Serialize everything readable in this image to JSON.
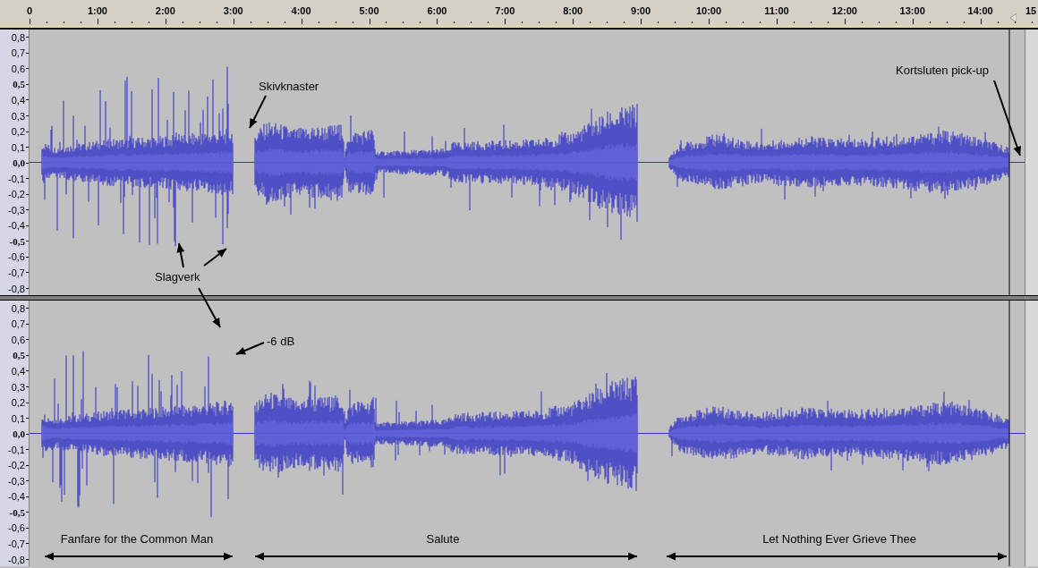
{
  "ruler": {
    "ticks": [
      "0",
      "1:00",
      "2:00",
      "3:00",
      "4:00",
      "5:00",
      "6:00",
      "7:00",
      "8:00",
      "9:00",
      "10:00",
      "11:00",
      "12:00",
      "13:00",
      "14:00",
      "15"
    ]
  },
  "tracks": [
    {
      "axis_labels": [
        {
          "text": "0,8",
          "bold": false
        },
        {
          "text": "0,7",
          "bold": false
        },
        {
          "text": "0,6",
          "bold": false
        },
        {
          "text": "0,5",
          "bold": true
        },
        {
          "text": "0,4",
          "bold": false
        },
        {
          "text": "0,3",
          "bold": false
        },
        {
          "text": "0,2",
          "bold": false
        },
        {
          "text": "0,1",
          "bold": false
        },
        {
          "text": "0,0",
          "bold": true
        },
        {
          "text": "-0,1",
          "bold": false
        },
        {
          "text": "-0,2",
          "bold": false
        },
        {
          "text": "-0,3",
          "bold": false
        },
        {
          "text": "-0,4",
          "bold": false
        },
        {
          "text": "-0,5",
          "bold": true
        },
        {
          "text": "-0,6",
          "bold": false
        },
        {
          "text": "-0,7",
          "bold": false
        },
        {
          "text": "-0,8",
          "bold": false
        }
      ]
    },
    {
      "axis_labels": [
        {
          "text": "0,8",
          "bold": false
        },
        {
          "text": "0,7",
          "bold": false
        },
        {
          "text": "0,6",
          "bold": false
        },
        {
          "text": "0,5",
          "bold": true
        },
        {
          "text": "0,4",
          "bold": false
        },
        {
          "text": "0,3",
          "bold": false
        },
        {
          "text": "0,2",
          "bold": false
        },
        {
          "text": "0,1",
          "bold": false
        },
        {
          "text": "0,0",
          "bold": true
        },
        {
          "text": "-0,1",
          "bold": false
        },
        {
          "text": "-0,2",
          "bold": false
        },
        {
          "text": "-0,3",
          "bold": false
        },
        {
          "text": "-0,4",
          "bold": false
        },
        {
          "text": "-0,5",
          "bold": true
        },
        {
          "text": "-0,6",
          "bold": false
        },
        {
          "text": "-0,7",
          "bold": false
        },
        {
          "text": "-0,8",
          "bold": false
        }
      ]
    }
  ],
  "annotations": [
    "Skivknaster",
    "Slagverk",
    "-6 dB",
    "Kortsluten pick-up"
  ],
  "songs": [
    "Fanfare for the Common Man",
    "Salute",
    "Let Nothing Ever Grieve Thee"
  ]
}
